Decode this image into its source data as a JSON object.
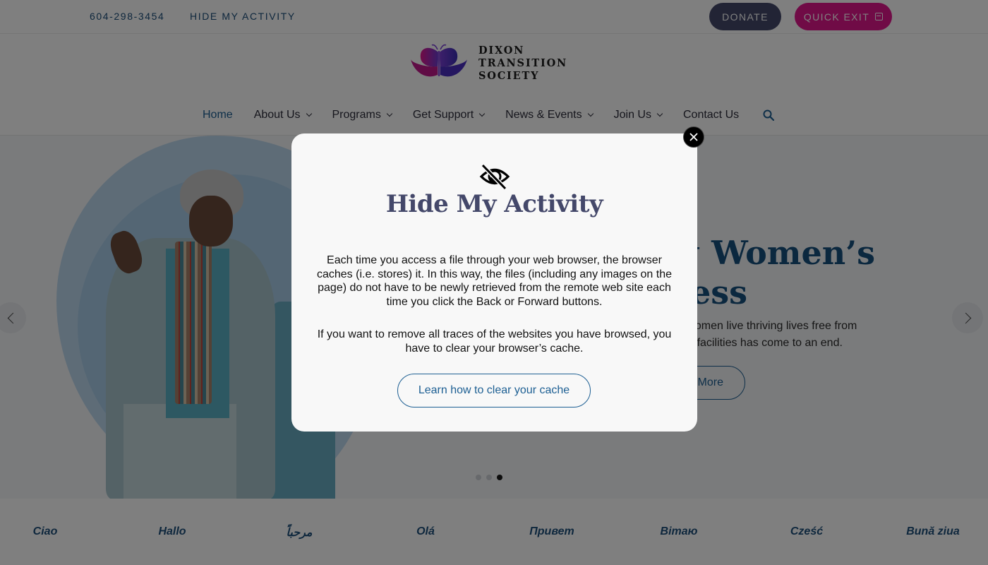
{
  "topbar": {
    "phone": "604-298-3454",
    "hide_activity": "HIDE MY ACTIVITY",
    "donate_label": "DONATE",
    "quick_exit_label": "QUICK EXIT",
    "quick_exit_icon": "exit-icon"
  },
  "logo": {
    "line1": "DIXON",
    "line2": "TRANSITION",
    "line3": "SOCIETY",
    "icon": "butterfly-logo-icon"
  },
  "nav": {
    "items": [
      {
        "label": "Home",
        "active": true,
        "has_dropdown": false
      },
      {
        "label": "About Us",
        "active": false,
        "has_dropdown": true
      },
      {
        "label": "Programs",
        "active": false,
        "has_dropdown": true
      },
      {
        "label": "Get Support",
        "active": false,
        "has_dropdown": true
      },
      {
        "label": "News & Events",
        "active": false,
        "has_dropdown": true
      },
      {
        "label": "Join Us",
        "active": false,
        "has_dropdown": true
      },
      {
        "label": "Contact Us",
        "active": false,
        "has_dropdown": false
      }
    ],
    "search_icon": "search-icon"
  },
  "hero": {
    "title_line1": "g Women’s",
    "title_line2": "cess",
    "text_line1": "g women live thriving lives free from",
    "text_line2": "our facilities has come to an end.",
    "button_label": "More",
    "slides_total": 3,
    "active_slide": 3
  },
  "greetings": [
    "Ciao",
    "Hallo",
    "مرحباً",
    "Olá",
    "Привет",
    "Вітаю",
    "Cześć",
    "Bună ziua"
  ],
  "modal": {
    "icon": "eye-slash-icon",
    "title": "Hide My Activity",
    "paragraph1": "Each time you access a file through your web browser, the browser caches (i.e. stores) it. In this way, the files (including any images on the page) do not have to be newly retrieved from the remote web site each time you click the Back or Forward buttons.",
    "paragraph2": "If you want to remove all traces of the websites you have browsed, you have to clear your browser’s cache.",
    "button_label": "Learn how to clear your cache",
    "close_icon": "close-icon"
  },
  "colors": {
    "brand_blue": "#1d5f93",
    "donate_bg": "#44486a",
    "quick_exit_bg": "#e0168c",
    "modal_title": "#44486a"
  }
}
